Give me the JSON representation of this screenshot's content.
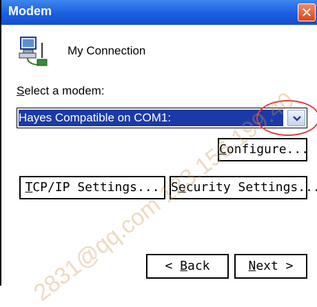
{
  "window": {
    "title": "Modem",
    "close_label": "✕"
  },
  "connection": {
    "name": "My Connection",
    "icon": "connection-icon"
  },
  "modem_select": {
    "label_prefix": "",
    "label_accel": "S",
    "label_rest": "elect a modem:",
    "selected_value": "Hayes Compatible on COM1:"
  },
  "buttons": {
    "configure": {
      "accel": "C",
      "rest": "onfigure..."
    },
    "tcpip": {
      "accel": "T",
      "rest": "CP/IP Settings..."
    },
    "security": {
      "pre": "S",
      "accel": "e",
      "rest": "curity Settings..."
    },
    "back": {
      "pre": "< ",
      "accel": "B",
      "rest": "ack"
    },
    "next": {
      "accel": "N",
      "rest": "ext >"
    }
  },
  "watermark": "2831@qq.com 123.156.199.40",
  "colors": {
    "titlebar": "#1a5fe0",
    "selection": "#1b3aa8",
    "annotation": "#e23b3b"
  }
}
